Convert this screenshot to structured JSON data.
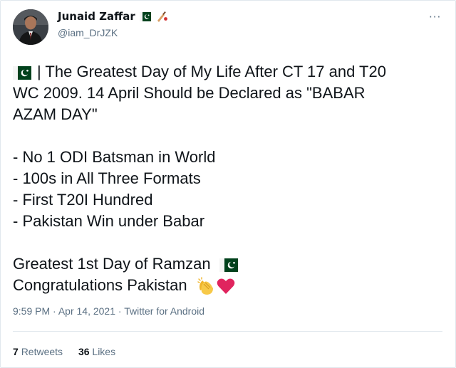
{
  "user": {
    "display_name": "Junaid Zaffar",
    "handle": "@iam_DrJZK",
    "name_badges": [
      "pakistan-flag",
      "cricket-bat"
    ]
  },
  "more_label": "···",
  "tweet": {
    "line1": "| The Greatest Day of My Life After CT 17 and T20",
    "line2": "WC 2009. 14 April Should be Declared as \"BABAR",
    "line3": "AZAM DAY\"",
    "bullets": [
      "- No 1 ODI Batsman in World",
      "- 100s in All Three Formats",
      "- First T20I Hundred",
      "- Pakistan Win under Babar"
    ],
    "closing1": "Greatest 1st Day of Ramzan",
    "closing2": "Congratulations Pakistan"
  },
  "meta": {
    "time": "9:59 PM",
    "date": "Apr 14, 2021",
    "source": "Twitter for Android",
    "separator": "·"
  },
  "stats": {
    "retweets_count": "7",
    "retweets_label": "Retweets",
    "likes_count": "36",
    "likes_label": "Likes"
  },
  "colors": {
    "text": "#0f1419",
    "muted": "#5b7083",
    "flag_green": "#01411c",
    "heart": "#e0245e",
    "clap": "#f5c33b"
  }
}
